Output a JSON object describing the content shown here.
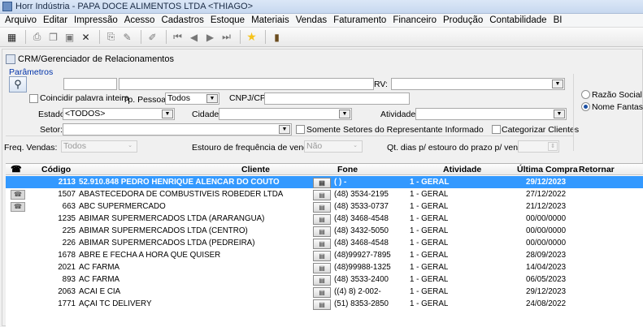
{
  "window": {
    "title": "Horr Indústria - PAPA DOCE ALIMENTOS LTDA <THIAGO>"
  },
  "menu": [
    "Arquivo",
    "Editar",
    "Impressão",
    "Acesso",
    "Cadastros",
    "Estoque",
    "Materiais",
    "Vendas",
    "Faturamento",
    "Financeiro",
    "Produção",
    "Contabilidade",
    "BI"
  ],
  "toolbar": {
    "icons": [
      "grid-icon",
      "print-preview-icon",
      "copy-icon",
      "save-icon",
      "delete-icon",
      "print-icon",
      "edit-icon",
      "pen-icon",
      "first-icon",
      "prev-icon",
      "next-icon",
      "last-icon",
      "star-icon",
      "exit-icon"
    ]
  },
  "panel": {
    "title": "CRM/Gerenciador de Relacionamentos",
    "params_label": "Parâmetros"
  },
  "filters": {
    "search1": "",
    "search2": "",
    "rv_label": "RV:",
    "rv_value": "",
    "coincidir_label": "Coincidir palavra inteira",
    "tp_pessoa_label": "Tp. Pessoa:",
    "tp_pessoa_value": "Todos",
    "cnpj_label": "CNPJ/CPF:",
    "cnpj_value": "",
    "estado_label": "Estado:",
    "estado_value": "<TODOS>",
    "cidade_label": "Cidade:",
    "cidade_value": "",
    "atividade_label": "Atividade:",
    "atividade_value": "",
    "setor_label": "Setor:",
    "setor_value": "",
    "somente_setores_label": "Somente Setores do Representante Informado",
    "categorizar_label": "Categorizar Clientes",
    "freq_label": "Freq. Vendas:",
    "freq_value": "Todos",
    "estouro_label": "Estouro de frequência de venda:",
    "estouro_value": "Não",
    "qt_dias_label": "Qt. dias p/ estouro do prazo p/ venda:",
    "qt_dias_value": ""
  },
  "options": {
    "razao_social": "Razão Social",
    "nome_fantasia": "Nome Fantasia",
    "selected": "nome_fantasia"
  },
  "grid": {
    "columns": [
      "Código",
      "Cliente",
      "Fone",
      "Atividade",
      "Última Compra",
      "Retornar Contato"
    ],
    "rows": [
      {
        "codigo": "2113",
        "cliente": "52.910.848 PEDRO HENRIQUE ALENCAR DO COUTO",
        "fone": "( )    -",
        "atividade": "1 - GERAL",
        "ultima": "29/12/2023",
        "selected": true
      },
      {
        "codigo": "1507",
        "cliente": "ABASTECEDORA DE COMBUSTIVEIS ROBEDER LTDA",
        "fone": "(48) 3534-2195",
        "atividade": "1 - GERAL",
        "ultima": "27/12/2022"
      },
      {
        "codigo": "663",
        "cliente": "ABC SUPERMERCADO",
        "fone": "(48) 3533-0737",
        "atividade": "1 - GERAL",
        "ultima": "21/12/2023"
      },
      {
        "codigo": "1235",
        "cliente": "ABIMAR SUPERMERCADOS LTDA (ARARANGUA)",
        "fone": "(48) 3468-4548",
        "atividade": "1 - GERAL",
        "ultima": "00/00/0000"
      },
      {
        "codigo": "225",
        "cliente": "ABIMAR SUPERMERCADOS LTDA (CENTRO)",
        "fone": "(48) 3432-5050",
        "atividade": "1 - GERAL",
        "ultima": "00/00/0000"
      },
      {
        "codigo": "226",
        "cliente": "ABIMAR SUPERMERCADOS LTDA (PEDREIRA)",
        "fone": "(48) 3468-4548",
        "atividade": "1 - GERAL",
        "ultima": "00/00/0000"
      },
      {
        "codigo": "1678",
        "cliente": "ABRE E FECHA A HORA QUE QUISER",
        "fone": "(48)99927-7895",
        "atividade": "1 - GERAL",
        "ultima": "28/09/2023"
      },
      {
        "codigo": "2021",
        "cliente": "AC FARMA",
        "fone": "(48)99988-1325",
        "atividade": "1 - GERAL",
        "ultima": "14/04/2023"
      },
      {
        "codigo": "893",
        "cliente": "AC FARMA",
        "fone": "(48) 3533-2400",
        "atividade": "1 - GERAL",
        "ultima": "06/05/2023"
      },
      {
        "codigo": "2063",
        "cliente": "ACAI E CIA",
        "fone": "((4) 8) 2-002-",
        "atividade": "1 - GERAL",
        "ultima": "29/12/2023"
      },
      {
        "codigo": "1771",
        "cliente": "AÇAI TC DELIVERY",
        "fone": "(51) 8353-2850",
        "atividade": "1 - GERAL",
        "ultima": "24/08/2022"
      }
    ]
  },
  "colors": {
    "selection": "#3399ff",
    "link_blue": "#0033aa"
  }
}
